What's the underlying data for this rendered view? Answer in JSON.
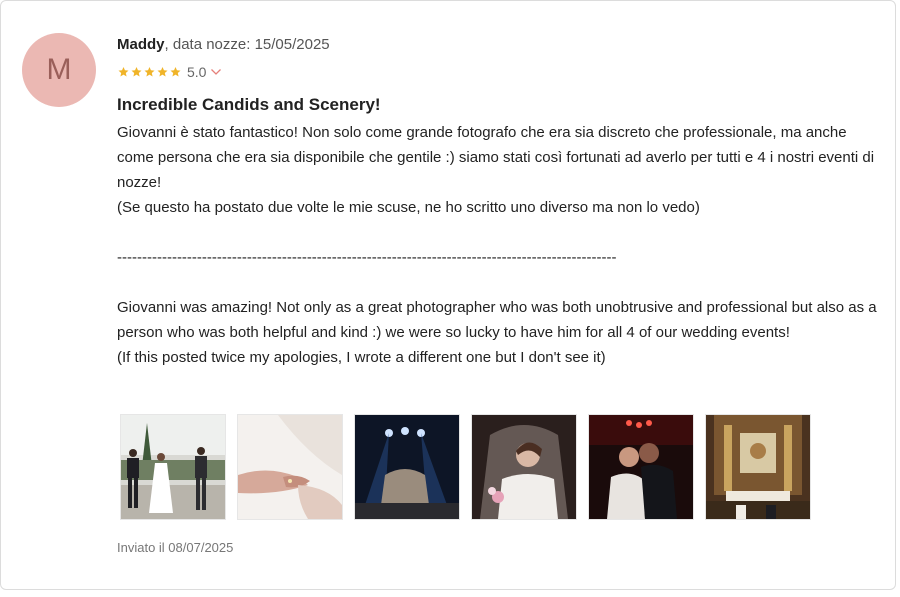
{
  "review": {
    "avatar_initial": "M",
    "author": "Maddy",
    "wedding_meta": ", data nozze: 15/05/2025",
    "rating": 5.0,
    "rating_label": "5.0",
    "title": "Incredible Candids and Scenery!",
    "body_it": [
      "Giovanni è stato fantastico! Non solo come grande fotografo che era sia discreto che professionale, ma anche come persona che era sia disponibile che gentile :) siamo stati così fortunati ad averlo per tutti e 4 i nostri eventi di nozze!",
      "(Se questo ha postato due volte le mie scuse, ne ho scritto uno diverso ma non lo vedo)"
    ],
    "separator": "----------------------------------------------------------------------------------------------------",
    "body_en": [
      "Giovanni was amazing! Not only as a great photographer who was both unobtrusive and professional but also as a person who was both helpful and kind :) we were so lucky to have him for all 4 of our wedding events!",
      "(If this posted twice my apologies, I wrote a different one but I don't see it)"
    ],
    "photos": [
      {
        "name": "photo-couple-walking"
      },
      {
        "name": "photo-holding-hands"
      },
      {
        "name": "photo-stage-lights"
      },
      {
        "name": "photo-bride-veil"
      },
      {
        "name": "photo-couple-dancing"
      },
      {
        "name": "photo-church-altar"
      }
    ],
    "sent_date": "Inviato il 08/07/2025"
  },
  "colors": {
    "avatar_bg": "#ebb8b3",
    "star": "#f0b429",
    "chevron": "#e5807a"
  }
}
